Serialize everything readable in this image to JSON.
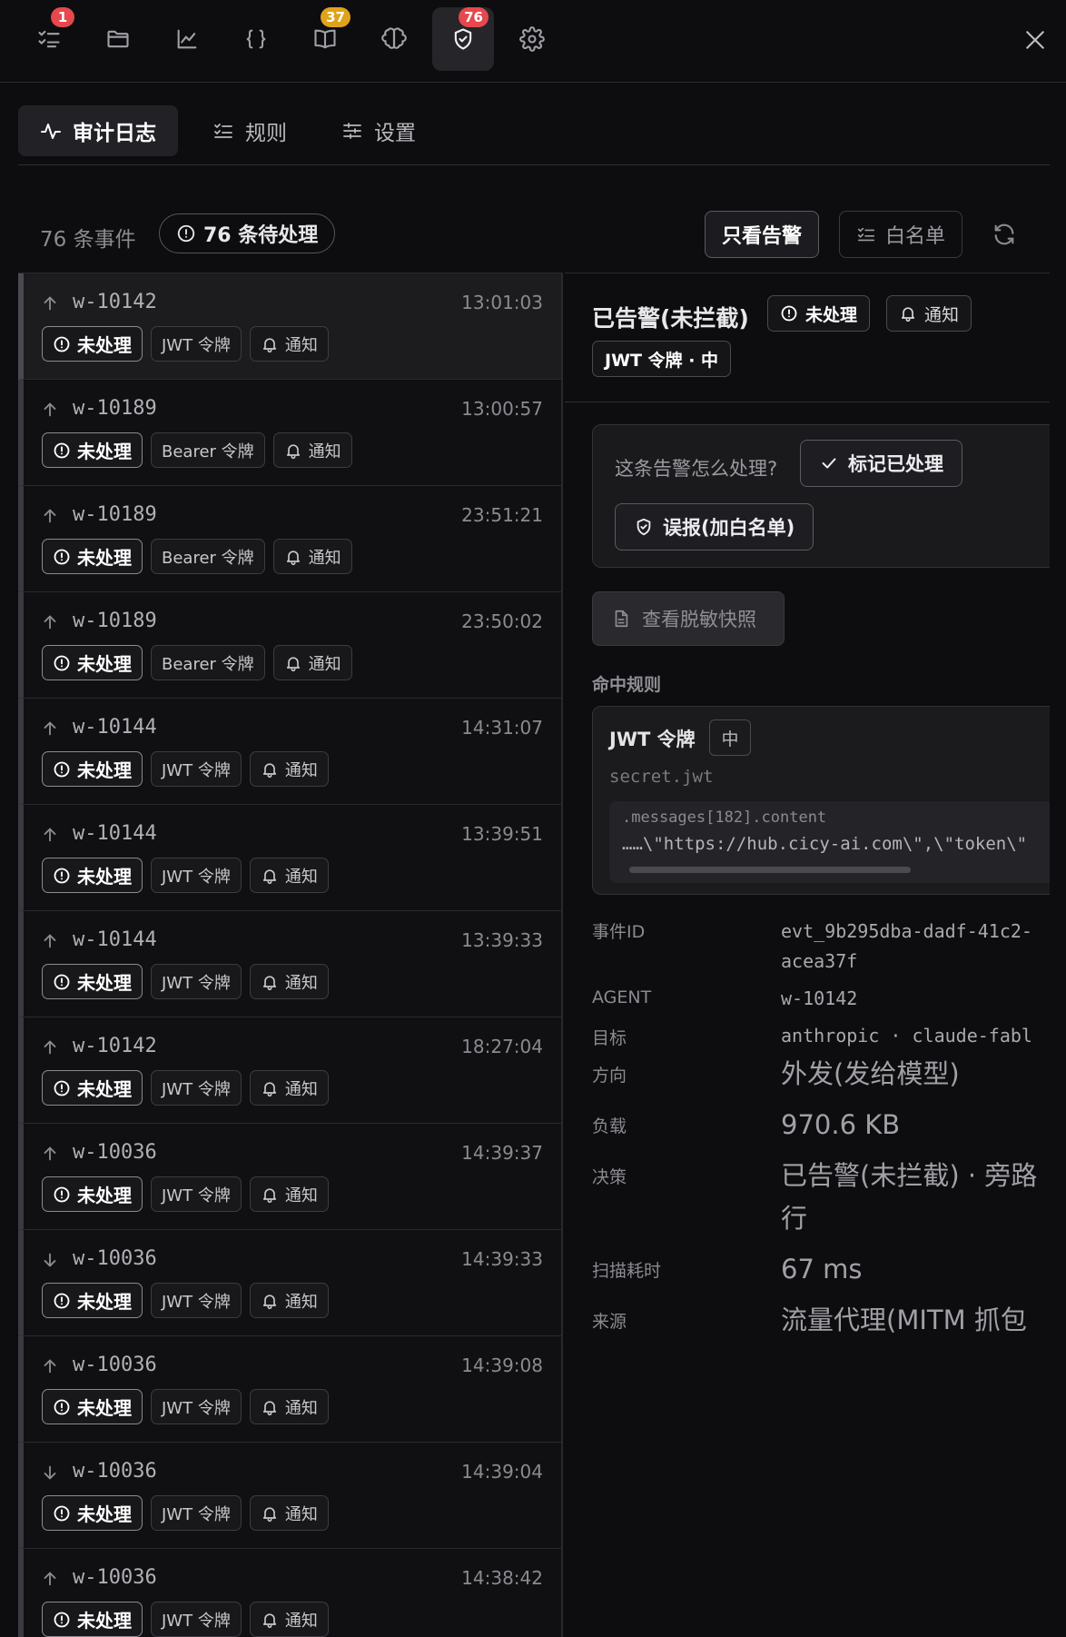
{
  "toolbar": {
    "buttons": [
      {
        "icon": "checklist-icon",
        "badge": "1",
        "badge_color": "#e5484d"
      },
      {
        "icon": "folder-icon",
        "badge": null
      },
      {
        "icon": "chart-icon",
        "badge": null
      },
      {
        "icon": "braces-icon",
        "badge": null
      },
      {
        "icon": "book-icon",
        "badge": "37",
        "badge_color": "#e0a21a"
      },
      {
        "icon": "brain-icon",
        "badge": null
      },
      {
        "icon": "shield-check-icon",
        "badge": "76",
        "badge_color": "#e5484d",
        "active": true
      },
      {
        "icon": "gear-icon",
        "badge": null
      }
    ],
    "close_icon": "close-icon"
  },
  "tabs": [
    {
      "label": "审计日志",
      "icon": "activity-icon",
      "active": true
    },
    {
      "label": "规则",
      "icon": "list-check-icon",
      "active": false
    },
    {
      "label": "设置",
      "icon": "sliders-icon",
      "active": false
    }
  ],
  "summary": {
    "event_count": "76 条事件",
    "pending": "76 条待处理",
    "alert_only": "只看告警",
    "whitelist": "白名单"
  },
  "events": [
    {
      "dir": "up",
      "agent": "w-10142",
      "time": "13:01:03",
      "status": "未处理",
      "type": "JWT 令牌",
      "action": "通知",
      "selected": true
    },
    {
      "dir": "up",
      "agent": "w-10189",
      "time": "13:00:57",
      "status": "未处理",
      "type": "Bearer 令牌",
      "action": "通知"
    },
    {
      "dir": "up",
      "agent": "w-10189",
      "time": "23:51:21",
      "status": "未处理",
      "type": "Bearer 令牌",
      "action": "通知"
    },
    {
      "dir": "up",
      "agent": "w-10189",
      "time": "23:50:02",
      "status": "未处理",
      "type": "Bearer 令牌",
      "action": "通知"
    },
    {
      "dir": "up",
      "agent": "w-10144",
      "time": "14:31:07",
      "status": "未处理",
      "type": "JWT 令牌",
      "action": "通知"
    },
    {
      "dir": "up",
      "agent": "w-10144",
      "time": "13:39:51",
      "status": "未处理",
      "type": "JWT 令牌",
      "action": "通知"
    },
    {
      "dir": "up",
      "agent": "w-10144",
      "time": "13:39:33",
      "status": "未处理",
      "type": "JWT 令牌",
      "action": "通知"
    },
    {
      "dir": "up",
      "agent": "w-10142",
      "time": "18:27:04",
      "status": "未处理",
      "type": "JWT 令牌",
      "action": "通知"
    },
    {
      "dir": "up",
      "agent": "w-10036",
      "time": "14:39:37",
      "status": "未处理",
      "type": "JWT 令牌",
      "action": "通知"
    },
    {
      "dir": "down",
      "agent": "w-10036",
      "time": "14:39:33",
      "status": "未处理",
      "type": "JWT 令牌",
      "action": "通知"
    },
    {
      "dir": "up",
      "agent": "w-10036",
      "time": "14:39:08",
      "status": "未处理",
      "type": "JWT 令牌",
      "action": "通知"
    },
    {
      "dir": "down",
      "agent": "w-10036",
      "time": "14:39:04",
      "status": "未处理",
      "type": "JWT 令牌",
      "action": "通知"
    },
    {
      "dir": "up",
      "agent": "w-10036",
      "time": "14:38:42",
      "status": "未处理",
      "type": "JWT 令牌",
      "action": "通知"
    }
  ],
  "detail": {
    "title": "已告警(未拦截)",
    "status": "未处理",
    "action": "通知",
    "rule_tag": "JWT 令牌 · 中",
    "question": "这条告警怎么处理?",
    "mark_done": "标记已处理",
    "false_positive": "误报(加白名单)",
    "snapshot": "查看脱敏快照",
    "hit_rules_label": "命中规则",
    "rule": {
      "name": "JWT 令牌",
      "severity": "中",
      "id": "secret.jwt",
      "path": ".messages[182].content",
      "snippet": "……\\\"https://hub.cicy-ai.com\\\",\\\"token\\\""
    },
    "fields": {
      "event_id_key": "事件ID",
      "event_id_line1": "evt_9b295dba-dadf-41c2-",
      "event_id_line2": "acea37f",
      "agent_key": "AGENT",
      "agent_val": "w-10142",
      "target_key": "目标",
      "target_val": "anthropic · claude-fabl",
      "direction_key": "方向",
      "direction_val": "外发(发给模型)",
      "payload_key": "负载",
      "payload_val": "970.6 KB",
      "decision_key": "决策",
      "decision_line1": "已告警(未拦截) · 旁路",
      "decision_line2": "行",
      "scan_key": "扫描耗时",
      "scan_val": "67 ms",
      "source_key": "来源",
      "source_val": "流量代理(MITM 抓包"
    }
  }
}
